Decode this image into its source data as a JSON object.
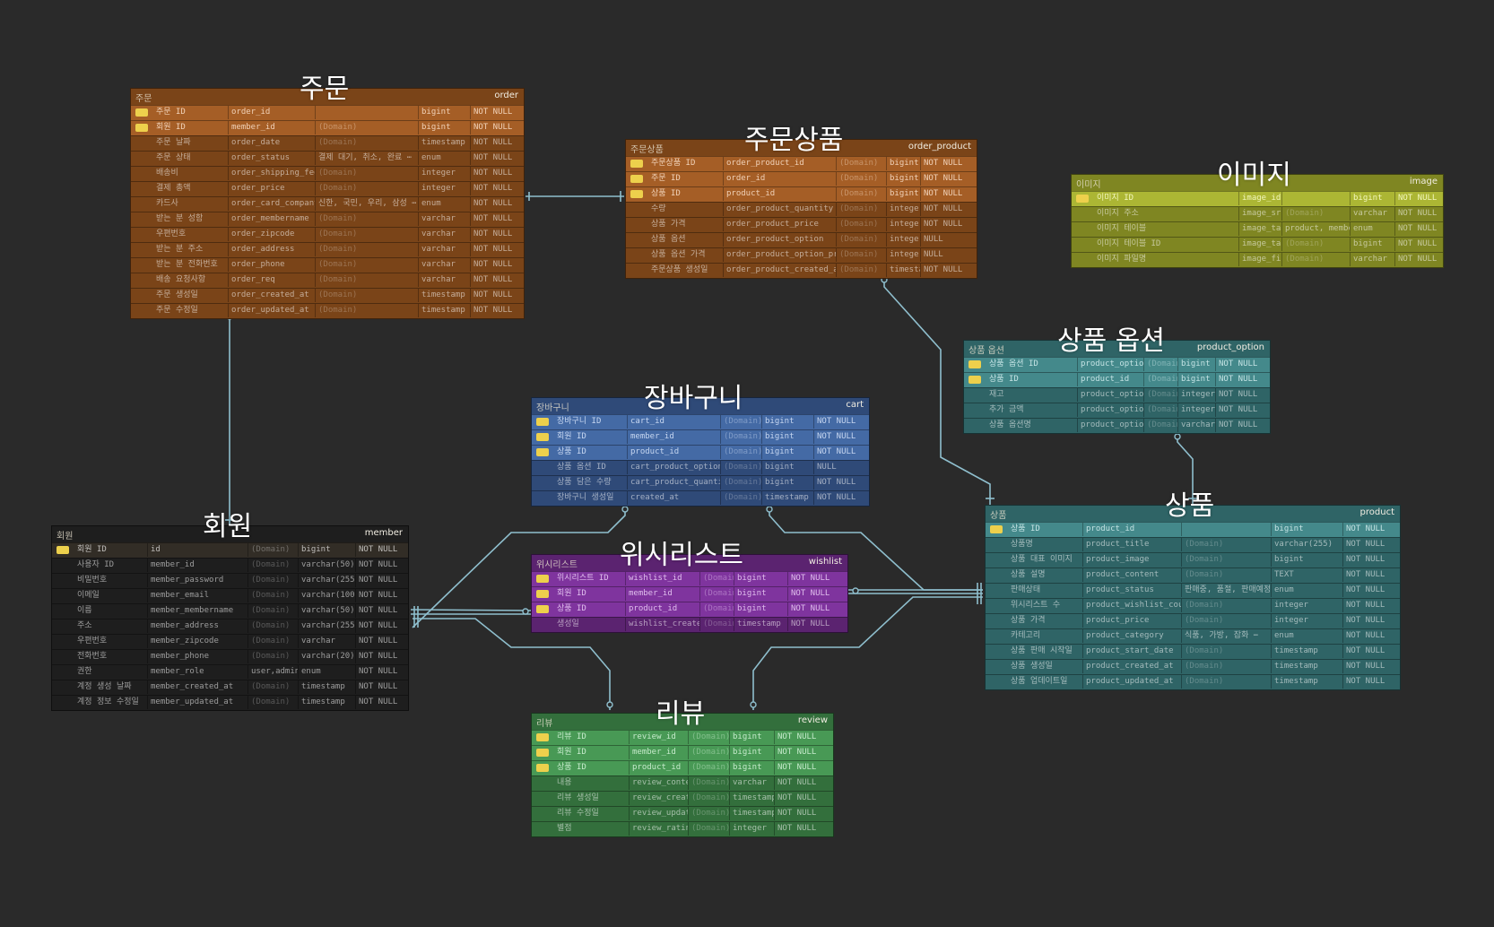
{
  "colors": {
    "background": "#2a2a2a",
    "connector": "#8fbfce",
    "key_icon": "#c9b040"
  },
  "tables": [
    {
      "id": "order",
      "display_title": "주문",
      "logical_name": "주문",
      "physical_name": "order",
      "color": "#7a4418",
      "key_row_color": "#8c5020",
      "columns": [
        {
          "key": true,
          "name": "주문 ID",
          "field": "order_id",
          "domain": "",
          "type": "bigint",
          "null": "NOT NULL"
        },
        {
          "key": true,
          "name": "회원 ID",
          "field": "member_id",
          "domain": "(Domain)",
          "type": "bigint",
          "null": "NOT NULL"
        },
        {
          "key": false,
          "name": "주문 날짜",
          "field": "order_date",
          "domain": "(Domain)",
          "type": "timestamp",
          "null": "NOT NULL"
        },
        {
          "key": false,
          "name": "주문 상태",
          "field": "order_status",
          "domain": "결제 대기, 취소, 완료 ⋯",
          "type": "enum",
          "null": "NOT NULL"
        },
        {
          "key": false,
          "name": "배송비",
          "field": "order_shipping_fee",
          "domain": "(Domain)",
          "type": "integer",
          "null": "NOT NULL"
        },
        {
          "key": false,
          "name": "결제 총액",
          "field": "order_price",
          "domain": "(Domain)",
          "type": "integer",
          "null": "NOT NULL"
        },
        {
          "key": false,
          "name": "카드사",
          "field": "order_card_company",
          "domain": "신한, 국민, 우리, 삼성 ⋯",
          "type": "enum",
          "null": "NOT NULL"
        },
        {
          "key": false,
          "name": "받는 분 성함",
          "field": "order_membername",
          "domain": "(Domain)",
          "type": "varchar",
          "null": "NOT NULL"
        },
        {
          "key": false,
          "name": "우편번호",
          "field": "order_zipcode",
          "domain": "(Domain)",
          "type": "varchar",
          "null": "NOT NULL"
        },
        {
          "key": false,
          "name": "받는 분 주소",
          "field": "order_address",
          "domain": "(Domain)",
          "type": "varchar",
          "null": "NOT NULL"
        },
        {
          "key": false,
          "name": "받는 분 전화번호",
          "field": "order_phone",
          "domain": "(Domain)",
          "type": "varchar",
          "null": "NOT NULL"
        },
        {
          "key": false,
          "name": "배송 요청사항",
          "field": "order_req",
          "domain": "(Domain)",
          "type": "varchar",
          "null": "NOT NULL"
        },
        {
          "key": false,
          "name": "주문 생성일",
          "field": "order_created_at",
          "domain": "(Domain)",
          "type": "timestamp",
          "null": "NOT NULL"
        },
        {
          "key": false,
          "name": "주문 수정일",
          "field": "order_updated_at",
          "domain": "(Domain)",
          "type": "timestamp",
          "null": "NOT NULL"
        }
      ]
    },
    {
      "id": "order_product",
      "display_title": "주문상품",
      "logical_name": "주문상품",
      "physical_name": "order_product",
      "color": "#7a4418",
      "key_row_color": "#8c5020",
      "columns": [
        {
          "key": true,
          "name": "주문상품 ID",
          "field": "order_product_id",
          "domain": "(Domain)",
          "type": "bigint",
          "null": "NOT NULL"
        },
        {
          "key": true,
          "name": "주문 ID",
          "field": "order_id",
          "domain": "(Domain)",
          "type": "bigint",
          "null": "NOT NULL"
        },
        {
          "key": true,
          "name": "상품 ID",
          "field": "product_id",
          "domain": "(Domain)",
          "type": "bigint",
          "null": "NOT NULL"
        },
        {
          "key": false,
          "name": "수량",
          "field": "order_product_quantity",
          "domain": "(Domain)",
          "type": "integer",
          "null": "NOT NULL"
        },
        {
          "key": false,
          "name": "상품 가격",
          "field": "order_product_price",
          "domain": "(Domain)",
          "type": "integer",
          "null": "NOT NULL"
        },
        {
          "key": false,
          "name": "상품 옵션",
          "field": "order_product_option",
          "domain": "(Domain)",
          "type": "integer",
          "null": "NULL"
        },
        {
          "key": false,
          "name": "상품 옵션 가격",
          "field": "order_product_option_price",
          "domain": "(Domain)",
          "type": "integer",
          "null": "NULL"
        },
        {
          "key": false,
          "name": "주문상품 생성일",
          "field": "order_product_created_at",
          "domain": "(Domain)",
          "type": "timestamp",
          "null": "NOT NULL"
        }
      ]
    },
    {
      "id": "image",
      "display_title": "이미지",
      "logical_name": "이미지",
      "physical_name": "image",
      "color": "#7f8622",
      "key_row_color": "#929a2c",
      "columns": [
        {
          "key": true,
          "name": "이미지 ID",
          "field": "image_id",
          "domain": "",
          "type": "bigint",
          "null": "NOT NULL"
        },
        {
          "key": false,
          "name": "이미지 주소",
          "field": "image_src",
          "domain": "(Domain)",
          "type": "varchar",
          "null": "NOT NULL"
        },
        {
          "key": false,
          "name": "이미지 테이블",
          "field": "image_table",
          "domain": "product, member, review ⋯",
          "type": "enum",
          "null": "NOT NULL"
        },
        {
          "key": false,
          "name": "이미지 테이블 ID",
          "field": "image_table_id",
          "domain": "(Domain)",
          "type": "bigint",
          "null": "NOT NULL"
        },
        {
          "key": false,
          "name": "이미지 파일명",
          "field": "image_filename",
          "domain": "(Domain)",
          "type": "varchar",
          "null": "NOT NULL"
        }
      ]
    },
    {
      "id": "product_option",
      "display_title": "상품 옵션",
      "logical_name": "상품 옵션",
      "physical_name": "product_option",
      "color": "#2f6466",
      "key_row_color": "#3a7476",
      "columns": [
        {
          "key": true,
          "name": "상품 옵션 ID",
          "field": "product_option_id",
          "domain": "(Domain)",
          "type": "bigint",
          "null": "NOT NULL"
        },
        {
          "key": true,
          "name": "상품 ID",
          "field": "product_id",
          "domain": "(Domain)",
          "type": "bigint",
          "null": "NOT NULL"
        },
        {
          "key": false,
          "name": "재고",
          "field": "product_option_stock",
          "domain": "(Domain)",
          "type": "integer",
          "null": "NOT NULL"
        },
        {
          "key": false,
          "name": "추가 금액",
          "field": "product_option_price",
          "domain": "(Domain)",
          "type": "integer",
          "null": "NOT NULL"
        },
        {
          "key": false,
          "name": "상품 옵션명",
          "field": "product_option_title",
          "domain": "(Domain)",
          "type": "varchar",
          "null": "NOT NULL"
        }
      ]
    },
    {
      "id": "cart",
      "display_title": "장바구니",
      "logical_name": "장바구니",
      "physical_name": "cart",
      "color": "#2f4a78",
      "key_row_color": "#3a5a8c",
      "columns": [
        {
          "key": true,
          "name": "장바구니 ID",
          "field": "cart_id",
          "domain": "(Domain)",
          "type": "bigint",
          "null": "NOT NULL"
        },
        {
          "key": true,
          "name": "회원 ID",
          "field": "member_id",
          "domain": "(Domain)",
          "type": "bigint",
          "null": "NOT NULL"
        },
        {
          "key": true,
          "name": "상품 ID",
          "field": "product_id",
          "domain": "(Domain)",
          "type": "bigint",
          "null": "NOT NULL"
        },
        {
          "key": false,
          "name": "상품 옵션 ID",
          "field": "cart_product_option_id",
          "domain": "(Domain)",
          "type": "bigint",
          "null": "NULL"
        },
        {
          "key": false,
          "name": "상품 담은 수량",
          "field": "cart_product_quantity",
          "domain": "(Domain)",
          "type": "bigint",
          "null": "NOT NULL"
        },
        {
          "key": false,
          "name": "장바구니 생성일",
          "field": "created_at",
          "domain": "(Domain)",
          "type": "timestamp",
          "null": "NOT NULL"
        }
      ]
    },
    {
      "id": "member",
      "display_title": "회원",
      "logical_name": "회원",
      "physical_name": "member",
      "color": "#1e1e1e",
      "key_row_color": "#2a2620",
      "columns": [
        {
          "key": true,
          "name": "회원 ID",
          "field": "id",
          "domain": "(Domain)",
          "type": "bigint",
          "null": "NOT NULL"
        },
        {
          "key": false,
          "name": "사용자 ID",
          "field": "member_id",
          "domain": "(Domain)",
          "type": "varchar(50)",
          "null": "NOT NULL"
        },
        {
          "key": false,
          "name": "비밀번호",
          "field": "member_password",
          "domain": "(Domain)",
          "type": "varchar(255)",
          "null": "NOT NULL"
        },
        {
          "key": false,
          "name": "이메일",
          "field": "member_email",
          "domain": "(Domain)",
          "type": "varchar(100)",
          "null": "NOT NULL"
        },
        {
          "key": false,
          "name": "이름",
          "field": "member_membername",
          "domain": "(Domain)",
          "type": "varchar(50)",
          "null": "NOT NULL"
        },
        {
          "key": false,
          "name": "주소",
          "field": "member_address",
          "domain": "(Domain)",
          "type": "varchar(255)",
          "null": "NOT NULL"
        },
        {
          "key": false,
          "name": "우편번호",
          "field": "member_zipcode",
          "domain": "(Domain)",
          "type": "varchar",
          "null": "NOT NULL"
        },
        {
          "key": false,
          "name": "전화번호",
          "field": "member_phone",
          "domain": "(Domain)",
          "type": "varchar(20)",
          "null": "NOT NULL"
        },
        {
          "key": false,
          "name": "권한",
          "field": "member_role",
          "domain": "user,admin",
          "type": "enum",
          "null": "NOT NULL"
        },
        {
          "key": false,
          "name": "계정 생성 날짜",
          "field": "member_created_at",
          "domain": "(Domain)",
          "type": "timestamp",
          "null": "NOT NULL"
        },
        {
          "key": false,
          "name": "계정 정보 수정일",
          "field": "member_updated_at",
          "domain": "(Domain)",
          "type": "timestamp",
          "null": "NOT NULL"
        }
      ]
    },
    {
      "id": "wishlist",
      "display_title": "위시리스트",
      "logical_name": "위시리스트",
      "physical_name": "wishlist",
      "color": "#5b2370",
      "key_row_color": "#6c2c86",
      "columns": [
        {
          "key": true,
          "name": "위시리스트 ID",
          "field": "wishlist_id",
          "domain": "(Domain)",
          "type": "bigint",
          "null": "NOT NULL"
        },
        {
          "key": true,
          "name": "회원 ID",
          "field": "member_id",
          "domain": "(Domain)",
          "type": "bigint",
          "null": "NOT NULL"
        },
        {
          "key": true,
          "name": "상품 ID",
          "field": "product_id",
          "domain": "(Domain)",
          "type": "bigint",
          "null": "NOT NULL"
        },
        {
          "key": false,
          "name": "생성일",
          "field": "wishlist_created_at",
          "domain": "(Domain)",
          "type": "timestamp",
          "null": "NOT NULL"
        }
      ]
    },
    {
      "id": "product",
      "display_title": "상품",
      "logical_name": "상품",
      "physical_name": "product",
      "color": "#2f6466",
      "key_row_color": "#3a7476",
      "columns": [
        {
          "key": true,
          "name": "상품 ID",
          "field": "product_id",
          "domain": "",
          "type": "bigint",
          "null": "NOT NULL"
        },
        {
          "key": false,
          "name": "상품명",
          "field": "product_title",
          "domain": "(Domain)",
          "type": "varchar(255)",
          "null": "NOT NULL"
        },
        {
          "key": false,
          "name": "상품 대표 이미지",
          "field": "product_image",
          "domain": "(Domain)",
          "type": "bigint",
          "null": "NOT NULL"
        },
        {
          "key": false,
          "name": "상품 설명",
          "field": "product_content",
          "domain": "(Domain)",
          "type": "TEXT",
          "null": "NOT NULL"
        },
        {
          "key": false,
          "name": "판매상태",
          "field": "product_status",
          "domain": "판매중, 품절, 판매예정 ⋯",
          "type": "enum",
          "null": "NOT NULL"
        },
        {
          "key": false,
          "name": "위시리스트 수",
          "field": "product_wishlist_count",
          "domain": "(Domain)",
          "type": "integer",
          "null": "NOT NULL"
        },
        {
          "key": false,
          "name": "상품 가격",
          "field": "product_price",
          "domain": "(Domain)",
          "type": "integer",
          "null": "NOT NULL"
        },
        {
          "key": false,
          "name": "카테고리",
          "field": "product_category",
          "domain": "식품, 가방, 잡화 ⋯",
          "type": "enum",
          "null": "NOT NULL"
        },
        {
          "key": false,
          "name": "상품 판매 시작일",
          "field": "product_start_date",
          "domain": "(Domain)",
          "type": "timestamp",
          "null": "NOT NULL"
        },
        {
          "key": false,
          "name": "상품 생성일",
          "field": "product_created_at",
          "domain": "(Domain)",
          "type": "timestamp",
          "null": "NOT NULL"
        },
        {
          "key": false,
          "name": "상품 업데이트일",
          "field": "product_updated_at",
          "domain": "(Domain)",
          "type": "timestamp",
          "null": "NOT NULL"
        }
      ]
    },
    {
      "id": "review",
      "display_title": "리뷰",
      "logical_name": "리뷰",
      "physical_name": "review",
      "color": "#336f3c",
      "key_row_color": "#3d8248",
      "columns": [
        {
          "key": true,
          "name": "리뷰 ID",
          "field": "review_id",
          "domain": "(Domain)",
          "type": "bigint",
          "null": "NOT NULL"
        },
        {
          "key": true,
          "name": "회원 ID",
          "field": "member_id",
          "domain": "(Domain)",
          "type": "bigint",
          "null": "NOT NULL"
        },
        {
          "key": true,
          "name": "상품 ID",
          "field": "product_id",
          "domain": "(Domain)",
          "type": "bigint",
          "null": "NOT NULL"
        },
        {
          "key": false,
          "name": "내용",
          "field": "review_content",
          "domain": "(Domain)",
          "type": "varchar",
          "null": "NOT NULL"
        },
        {
          "key": false,
          "name": "리뷰 생성일",
          "field": "review_created_at",
          "domain": "(Domain)",
          "type": "timestamp",
          "null": "NOT NULL"
        },
        {
          "key": false,
          "name": "리뷰 수정일",
          "field": "review_updated_at",
          "domain": "(Domain)",
          "type": "timestamp",
          "null": "NOT NULL"
        },
        {
          "key": false,
          "name": "별점",
          "field": "review_rating",
          "domain": "(Domain)",
          "type": "integer",
          "null": "NOT NULL"
        }
      ]
    }
  ]
}
